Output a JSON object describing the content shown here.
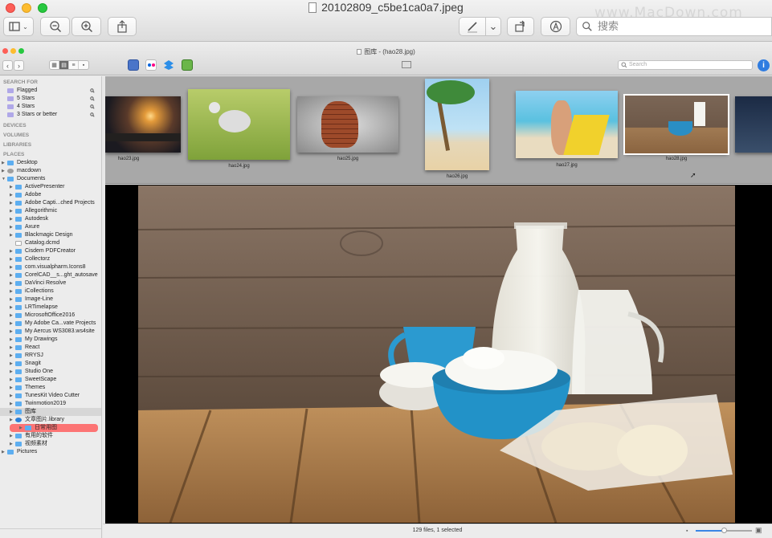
{
  "outer": {
    "title": "20102809_c5be1ca0a7.jpeg",
    "search_placeholder": "搜索",
    "watermark": "www.MacDown.com",
    "icons": [
      "sidebar-toggle-icon",
      "zoom-out-icon",
      "zoom-in-icon",
      "share-icon",
      "markup-pen-icon",
      "rotate-icon",
      "annotate-icon",
      "search-icon"
    ]
  },
  "inner": {
    "title": "图库 - (hao28.jpg)",
    "search_placeholder": "Search",
    "info_label": "i"
  },
  "sidebar": {
    "search_for_header": "SEARCH FOR",
    "search_items": [
      "Flagged",
      "5 Stars",
      "4 Stars",
      "3 Stars or better"
    ],
    "devices_header": "DEVICES",
    "volumes_header": "VOLUMES",
    "libraries_header": "LIBRARIES",
    "places_header": "PLACES",
    "places": [
      "Desktop",
      "macdown",
      "Documents"
    ],
    "documents_children": [
      "ActivePresenter",
      "Adobe",
      "Adobe Capti...ched Projects",
      "Allegorithmic",
      "Autodesk",
      "Axure",
      "Blackmagic Design",
      "Catalog.dcmd",
      "Cisdem PDFCreator",
      "Collectorz",
      "com.visualpharm.Icons8",
      "CorelCAD__s...ght_autosave",
      "DaVinci Resolve",
      "iCollections",
      "Image-Line",
      "LRTimelapse",
      "MicrosoftOffice2016",
      "My Adobe Ca...vate Projects",
      "My Aercus WS3083.ws4site",
      "My Drawings",
      "React",
      "RRYSJ",
      "Snagit",
      "Studio One",
      "SweetScape",
      "Themes",
      "TunesKit Video Cutter",
      "Twinmotion2019",
      "图库",
      "文章图片.library",
      "日常用图",
      "有用的软件",
      "视频素材"
    ],
    "last_place": "Pictures"
  },
  "filmstrip": {
    "items": [
      {
        "label": "hao23.jpg"
      },
      {
        "label": "hao24.jpg"
      },
      {
        "label": "hao25.jpg"
      },
      {
        "label": "hao26.jpg"
      },
      {
        "label": "hao27.jpg"
      },
      {
        "label": "hao28.jpg"
      }
    ]
  },
  "status": {
    "text": "129 files, 1 selected",
    "zoom_fraction": 0.5
  }
}
